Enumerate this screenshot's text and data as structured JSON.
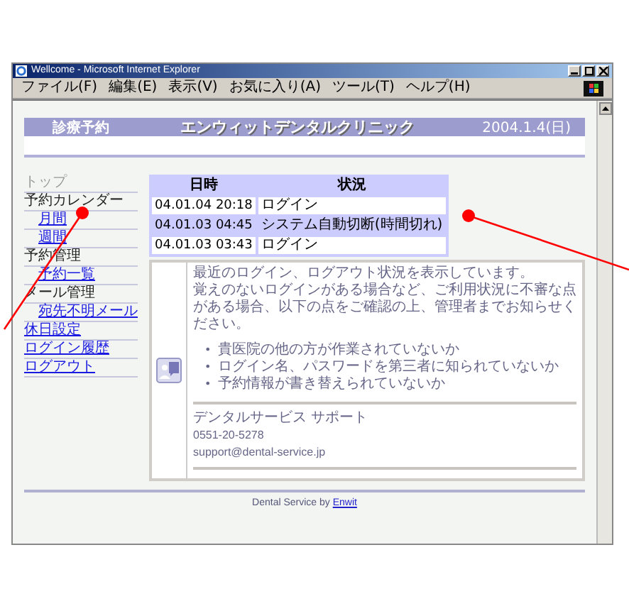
{
  "window": {
    "title": "Wellcome - Microsoft Internet Explorer"
  },
  "menu": [
    "ファイル(F)",
    "編集(E)",
    "表示(V)",
    "お気に入り(A)",
    "ツール(T)",
    "ヘルプ(H)"
  ],
  "header": {
    "section": "診療予約",
    "clinic": "エンウィットデンタルクリニック",
    "date": "2004.1.4(日)"
  },
  "sidebar": {
    "items": [
      {
        "label": "トップ",
        "kind": "current"
      },
      {
        "label": "予約カレンダー",
        "kind": "heading",
        "children": [
          {
            "label": "月間",
            "kind": "link"
          },
          {
            "label": "週間",
            "kind": "link"
          }
        ]
      },
      {
        "label": "予約管理",
        "kind": "heading",
        "children": [
          {
            "label": "予約一覧",
            "kind": "link"
          }
        ]
      },
      {
        "label": "メール管理",
        "kind": "heading",
        "children": [
          {
            "label": "宛先不明メール",
            "kind": "link"
          }
        ]
      },
      {
        "label": "休日設定",
        "kind": "link"
      },
      {
        "label": "ログイン履歴",
        "kind": "link"
      },
      {
        "label": "ログアウト",
        "kind": "link"
      }
    ]
  },
  "table": {
    "columns": [
      "日時",
      "状況"
    ],
    "rows": [
      [
        "04.01.04 20:18",
        "ログイン"
      ],
      [
        "04.01.03 04:45",
        "システム自動切断(時間切れ)"
      ],
      [
        "04.01.03 03:43",
        "ログイン"
      ]
    ]
  },
  "info": {
    "paragraphs": [
      "最近のログイン、ログアウト状況を表示しています。",
      "覚えのないログインがある場合など、ご利用状況に不審な点がある場合、以下の点をご確認の上、管理者までお知らせください。"
    ],
    "bullets": [
      {
        "marker": "•",
        "text": "貴医院の他の方が作業されていないか"
      },
      {
        "marker": "•",
        "text": "ログイン名、パスワードを第三者に知られていないか"
      },
      {
        "marker": "•",
        "text": "予約情報が書き替えられていないか"
      }
    ],
    "support": {
      "name": "デンタルサービス サポート",
      "phone": "0551-20-5278",
      "email": "support@dental-service.jp"
    }
  },
  "footer": {
    "text": "Dental Service by",
    "link": "Enwit"
  }
}
